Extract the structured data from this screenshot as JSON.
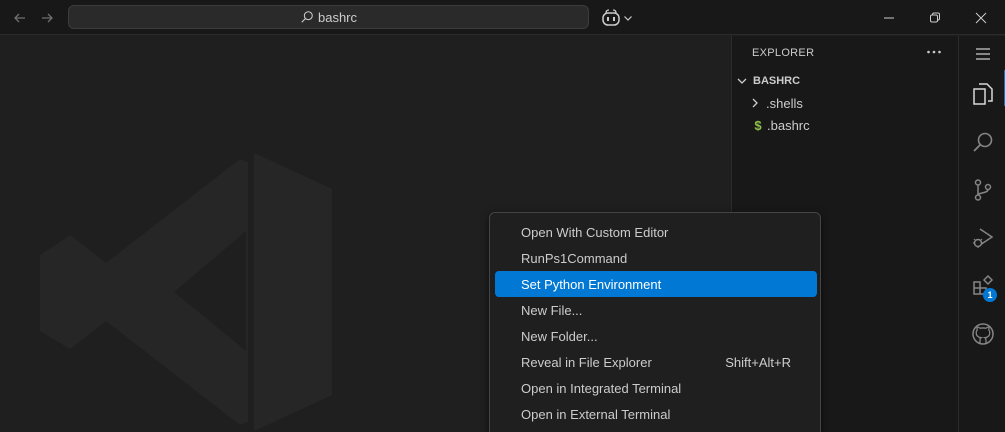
{
  "titlebar": {
    "search_text": "bashrc"
  },
  "explorer": {
    "header": "EXPLORER",
    "folder_name": "BASHRC",
    "items": [
      {
        "label": ".shells",
        "type": "folder"
      },
      {
        "label": ".bashrc",
        "type": "file",
        "icon_glyph": "$"
      }
    ]
  },
  "context_menu": {
    "items": [
      {
        "label": "Open With Custom Editor",
        "keybinding": ""
      },
      {
        "label": "RunPs1Command",
        "keybinding": ""
      },
      {
        "label": "Set Python Environment",
        "keybinding": "",
        "selected": true
      },
      {
        "label": "New File...",
        "keybinding": ""
      },
      {
        "label": "New Folder...",
        "keybinding": ""
      },
      {
        "label": "Reveal in File Explorer",
        "keybinding": "Shift+Alt+R"
      },
      {
        "label": "Open in Integrated Terminal",
        "keybinding": ""
      },
      {
        "label": "Open in External Terminal",
        "keybinding": ""
      }
    ]
  },
  "activitybar": {
    "items": [
      {
        "name": "explorer-icon",
        "active": true
      },
      {
        "name": "search-icon"
      },
      {
        "name": "source-control-icon"
      },
      {
        "name": "run-debug-icon"
      },
      {
        "name": "extensions-icon",
        "badge": "1"
      },
      {
        "name": "github-icon"
      }
    ]
  },
  "colors": {
    "accent": "#0078d4",
    "background": "#1f1f1f",
    "sidebar_bg": "#181818",
    "bash_file_icon": "#8dc149"
  }
}
